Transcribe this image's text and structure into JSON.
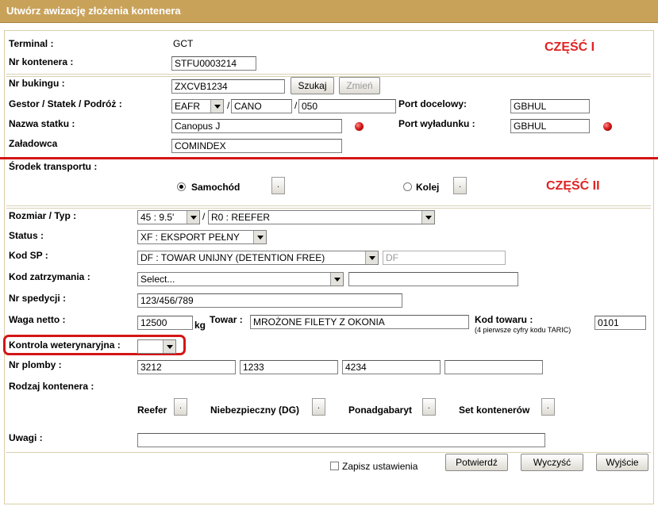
{
  "window": {
    "title": "Utwórz awizację złożenia kontenera"
  },
  "parts": {
    "part1": "CZĘŚĆ I",
    "part2": "CZĘŚĆ II"
  },
  "terminal": {
    "label": "Terminal :",
    "value": "GCT"
  },
  "container_no": {
    "label": "Nr kontenera :",
    "value": "STFU0003214"
  },
  "booking": {
    "label": "Nr bukingu :",
    "value": "ZXCVB1234",
    "search_label": "Szukaj",
    "change_label": "Zmień"
  },
  "gestor": {
    "label": "Gestor / Statek / Podróż :",
    "gestor": "EAFR",
    "vessel": "CANO",
    "voyage": "050"
  },
  "port_dest": {
    "label": "Port docelowy:",
    "value": "GBHUL"
  },
  "vessel_name": {
    "label": "Nazwa statku :",
    "value": "Canopus J"
  },
  "port_unload": {
    "label": "Port wyładunku :",
    "value": "GBHUL"
  },
  "shipper": {
    "label": "Załadowca",
    "value": "COMINDEX"
  },
  "transport": {
    "label": "Środek transportu :",
    "car_label": "Samochód",
    "rail_label": "Kolej",
    "selected": "Samochód",
    "btn": "."
  },
  "size_type": {
    "label": "Rozmiar / Typ :",
    "size": "45 : 9.5'",
    "type": "R0 : REEFER"
  },
  "status": {
    "label": "Status :",
    "value": "XF : EKSPORT PEŁNY"
  },
  "kod_sp": {
    "label": "Kod SP :",
    "value": "DF : TOWAR UNIJNY (DETENTION FREE)",
    "code": "DF"
  },
  "hold_code": {
    "label": "Kod zatrzymania :",
    "value": "Select...",
    "extra": ""
  },
  "forwarding_no": {
    "label": "Nr spedycji :",
    "value": "123/456/789"
  },
  "net_weight": {
    "label": "Waga netto :",
    "value": "12500",
    "unit": "kg"
  },
  "goods": {
    "label": "Towar :",
    "value": "MROŻONE FILETY Z OKONIA"
  },
  "goods_code": {
    "label": "Kod towaru :",
    "hint": "(4 pierwsze cyfry kodu TARIC)",
    "value": "0101"
  },
  "vet_control": {
    "label": "Kontrola weterynaryjna :",
    "value": ""
  },
  "seals": {
    "label": "Nr plomby :",
    "values": [
      "3212",
      "1233",
      "4234",
      ""
    ]
  },
  "container_kind": {
    "label": "Rodzaj kontenera :",
    "options": [
      "Reefer",
      "Niebezpieczny (DG)",
      "Ponadgabaryt",
      "Set kontenerów"
    ],
    "btn": "."
  },
  "remarks": {
    "label": "Uwagi :",
    "value": ""
  },
  "footer": {
    "save_settings": "Zapisz ustawienia",
    "save_settings_checked": false,
    "confirm": "Potwierdź",
    "clear": "Wyczyść",
    "exit": "Wyjście"
  },
  "colors": {
    "header": "#c9a25a",
    "accent_red": "#d41515"
  }
}
